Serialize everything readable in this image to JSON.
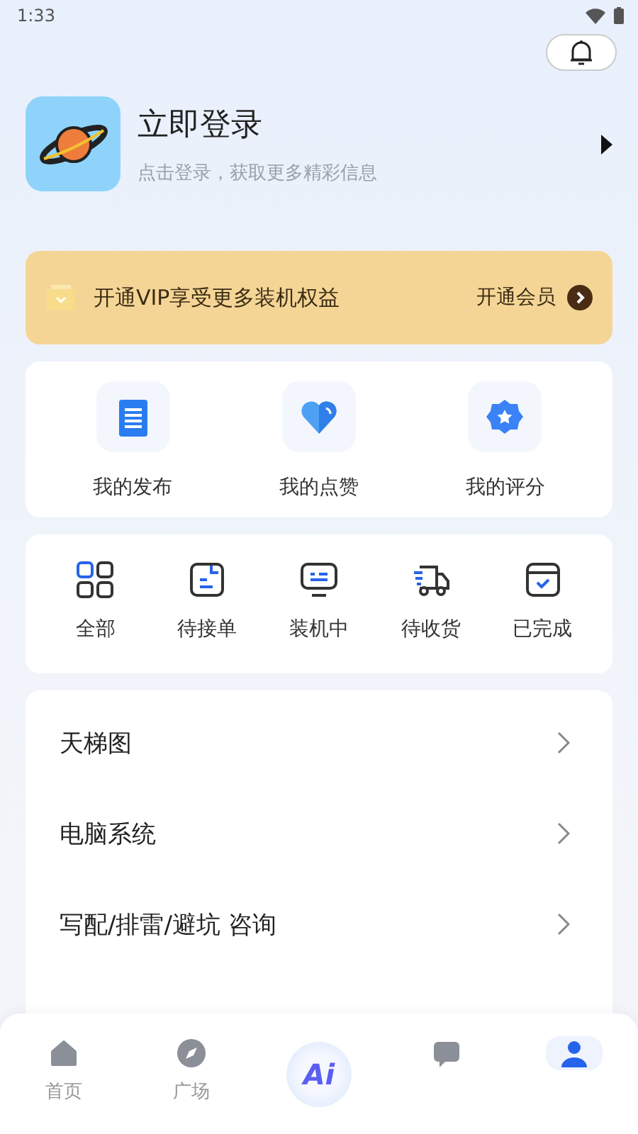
{
  "status_bar": {
    "time": "1:33"
  },
  "profile": {
    "title": "立即登录",
    "subtitle": "点击登录，获取更多精彩信息"
  },
  "vip_banner": {
    "text": "开通VIP享受更多装机权益",
    "action": "开通会员"
  },
  "shortcuts": [
    {
      "label": "我的发布",
      "kind": "document"
    },
    {
      "label": "我的点赞",
      "kind": "heart"
    },
    {
      "label": "我的评分",
      "kind": "star"
    }
  ],
  "orders": [
    {
      "label": "全部",
      "kind": "grid"
    },
    {
      "label": "待接单",
      "kind": "note"
    },
    {
      "label": "装机中",
      "kind": "monitor"
    },
    {
      "label": "待收货",
      "kind": "truck"
    },
    {
      "label": "已完成",
      "kind": "done"
    }
  ],
  "menu": [
    {
      "label": "天梯图"
    },
    {
      "label": "电脑系统"
    },
    {
      "label": "写配/排雷/避坑 咨询"
    }
  ],
  "bottom_nav": [
    {
      "label": "首页",
      "kind": "home",
      "selected": false
    },
    {
      "label": "广场",
      "kind": "compass",
      "selected": false
    },
    {
      "label": "Ai",
      "kind": "ai",
      "selected": false
    },
    {
      "kind": "message",
      "selected": false
    },
    {
      "kind": "person",
      "selected": true
    }
  ]
}
